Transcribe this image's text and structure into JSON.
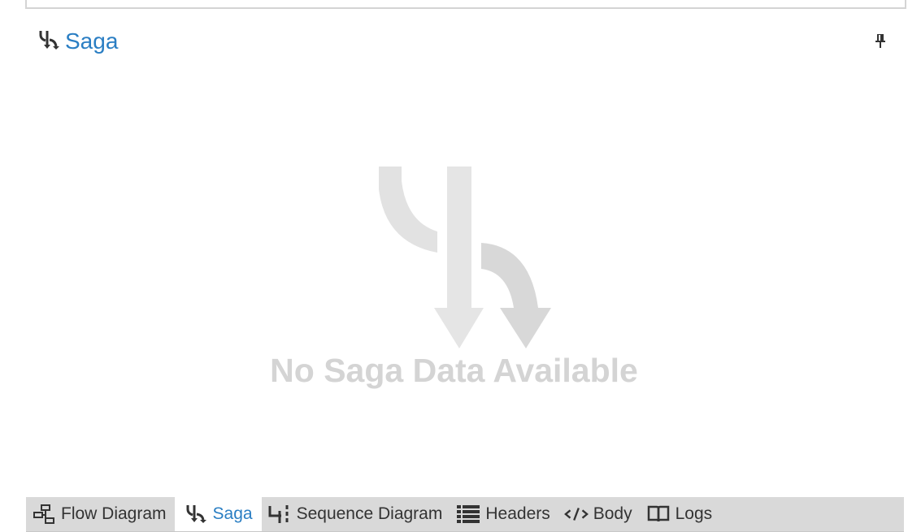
{
  "pane": {
    "title": "Saga",
    "title_icon": "saga-icon",
    "pin_icon": "pin-icon"
  },
  "empty_state": {
    "icon": "saga-large-icon",
    "message": "No Saga Data Available"
  },
  "tabs": [
    {
      "label": "Flow Diagram",
      "icon": "flow-diagram-icon",
      "active": false
    },
    {
      "label": "Saga",
      "icon": "saga-icon",
      "active": true
    },
    {
      "label": "Sequence Diagram",
      "icon": "sequence-diagram-icon",
      "active": false
    },
    {
      "label": "Headers",
      "icon": "headers-icon",
      "active": false
    },
    {
      "label": "Body",
      "icon": "body-icon",
      "active": false
    },
    {
      "label": "Logs",
      "icon": "logs-icon",
      "active": false
    }
  ],
  "colors": {
    "accent": "#2a7ec3",
    "tab_strip": "#d9d9d9",
    "empty_fg": "#d4d4d4"
  }
}
